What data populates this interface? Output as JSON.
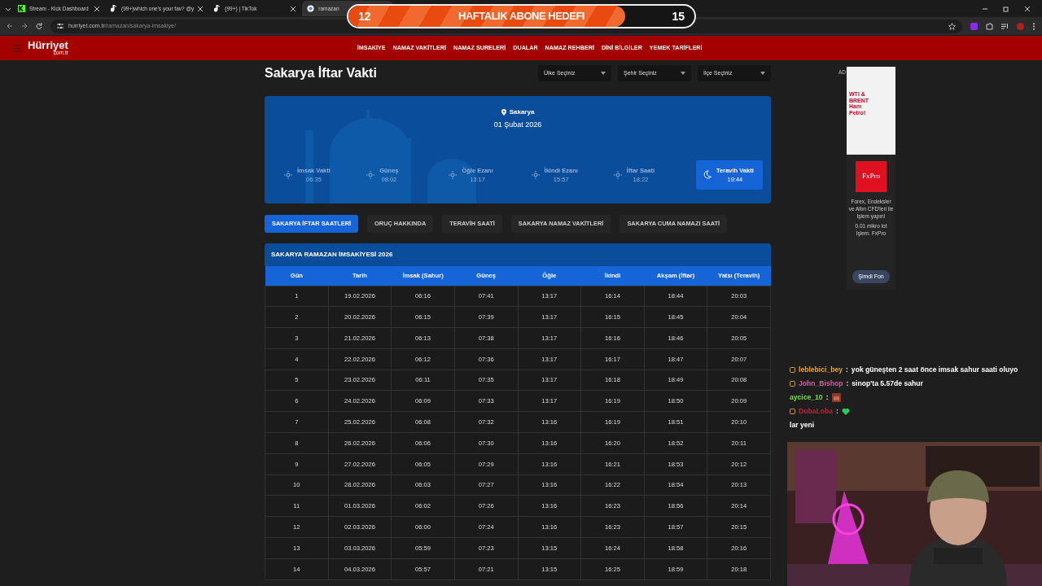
{
  "browser": {
    "tabs": [
      {
        "title": "Stream - Kick Dashboard",
        "kind": "kick",
        "selected": false
      },
      {
        "title": "(99+)which one's your fav? @y",
        "kind": "tiktok",
        "selected": false
      },
      {
        "title": "(99+) | TikTok",
        "kind": "tiktok",
        "selected": false
      },
      {
        "title": "ramazan",
        "kind": "google",
        "selected": true
      }
    ],
    "url_host": "hurriyet.com.tr",
    "url_path": "/ramazan/sakarya-imsakiye/"
  },
  "goal": {
    "current": "12",
    "title": "HAFTALIK ABONE HEDEFI",
    "target": "15",
    "level": 0.8
  },
  "header": {
    "logo": "Hürriyet",
    "logo_sub": "com.tr",
    "nav": [
      "İMSAKİYE",
      "NAMAZ VAKİTLERİ",
      "NAMAZ SURELERİ",
      "DUALAR",
      "NAMAZ REHBERİ",
      "DİNİ BİLGİLER",
      "YEMEK TARİFLERİ"
    ]
  },
  "page_title": "Sakarya İftar Vakti",
  "selects": [
    "Ülke Seçiniz",
    "Şehir Seçiniz",
    "İlçe Seçiniz"
  ],
  "hero": {
    "city": "Sakarya",
    "date": "01 Şubat 2026",
    "times": [
      {
        "label": "İmsak Vakti",
        "time": "06:35",
        "selected": false
      },
      {
        "label": "Güneş",
        "time": "08:02",
        "selected": false
      },
      {
        "label": "Öğle Ezanı",
        "time": "13:17",
        "selected": false
      },
      {
        "label": "İkindi Ezanı",
        "time": "15:57",
        "selected": false
      },
      {
        "label": "İftar Saati",
        "time": "18:22",
        "selected": false
      },
      {
        "label": "Teravih Vakti",
        "time": "19:44",
        "selected": true
      }
    ]
  },
  "subtabs": [
    {
      "label": "SAKARYA İFTAR SAATLERİ",
      "selected": true
    },
    {
      "label": "ORUÇ HAKKINDA",
      "selected": false
    },
    {
      "label": "TERAVİH SAATİ",
      "selected": false
    },
    {
      "label": "SAKARYA NAMAZ VAKİTLERİ",
      "selected": false
    },
    {
      "label": "SAKARYA CUMA NAMAZI SAATİ",
      "selected": false
    }
  ],
  "table": {
    "title": "SAKARYA RAMAZAN İMSAKİYESİ 2026",
    "columns": [
      "Gün",
      "Tarih",
      "İmsak (Sahur)",
      "Güneş",
      "Öğle",
      "İkindi",
      "Akşam (İftar)",
      "Yatsı (Teravih)"
    ],
    "rows": [
      [
        "1",
        "19.02.2026",
        "06:16",
        "07:41",
        "13:17",
        "16:14",
        "18:44",
        "20:03"
      ],
      [
        "2",
        "20.02.2026",
        "06:15",
        "07:39",
        "13:17",
        "16:15",
        "18:45",
        "20:04"
      ],
      [
        "3",
        "21.02.2026",
        "06:13",
        "07:38",
        "13:17",
        "16:16",
        "18:46",
        "20:05"
      ],
      [
        "4",
        "22.02.2026",
        "06:12",
        "07:36",
        "13:17",
        "16:17",
        "18:47",
        "20:07"
      ],
      [
        "5",
        "23.02.2026",
        "06:11",
        "07:35",
        "13:17",
        "16:18",
        "18:49",
        "20:08"
      ],
      [
        "6",
        "24.02.2026",
        "06:09",
        "07:33",
        "13:17",
        "16:19",
        "18:50",
        "20:09"
      ],
      [
        "7",
        "25.02.2026",
        "06:08",
        "07:32",
        "13:16",
        "16:19",
        "18:51",
        "20:10"
      ],
      [
        "8",
        "26.02.2026",
        "06:06",
        "07:30",
        "13:16",
        "16:20",
        "18:52",
        "20:11"
      ],
      [
        "9",
        "27.02.2026",
        "06:05",
        "07:29",
        "13:16",
        "16:21",
        "18:53",
        "20:12"
      ],
      [
        "10",
        "28.02.2026",
        "06:03",
        "07:27",
        "13:16",
        "16:22",
        "18:54",
        "20:13"
      ],
      [
        "11",
        "01.03.2026",
        "06:02",
        "07:26",
        "13:16",
        "16:23",
        "18:56",
        "20:14"
      ],
      [
        "12",
        "02.03.2026",
        "06:00",
        "07:24",
        "13:16",
        "16:23",
        "18:57",
        "20:15"
      ],
      [
        "13",
        "03.03.2026",
        "05:59",
        "07:23",
        "13:15",
        "16:24",
        "18:58",
        "20:16"
      ],
      [
        "14",
        "04.03.2026",
        "05:57",
        "07:21",
        "13:15",
        "16:25",
        "18:59",
        "20:18"
      ]
    ]
  },
  "ad": {
    "label": "AD",
    "banner_text": "WTI & BRENT Ham Petrol",
    "brand": "FxPro",
    "text": "Forex, Endeksler ve Altın CFD'leri ile İşlem yapın!",
    "subtext": "0.01 mikro lot İşlem. FxPro",
    "button": "Şimdi Fon"
  },
  "chat": [
    {
      "user": "leblebici_bey",
      "color": "#e8a33a",
      "badge": true,
      "kind": "text",
      "separator": ":",
      "text": "yok güneşten 2 saat önce imsak sahur saati oluyo"
    },
    {
      "user": "John_Bishop",
      "color": "#d45fa0",
      "badge": true,
      "kind": "text",
      "separator": ":",
      "text": "sinop'ta 5.57de sahur"
    },
    {
      "user": "aycice_10",
      "color": "#6fe03a",
      "badge": false,
      "kind": "emote",
      "separator": ":"
    },
    {
      "user": "DubaLoba",
      "color": "#c0203c",
      "badge": true,
      "kind": "heart",
      "separator": ":"
    },
    {
      "kind": "plain",
      "text": "lar yeni"
    }
  ],
  "webcam": {
    "kind": "picture"
  }
}
